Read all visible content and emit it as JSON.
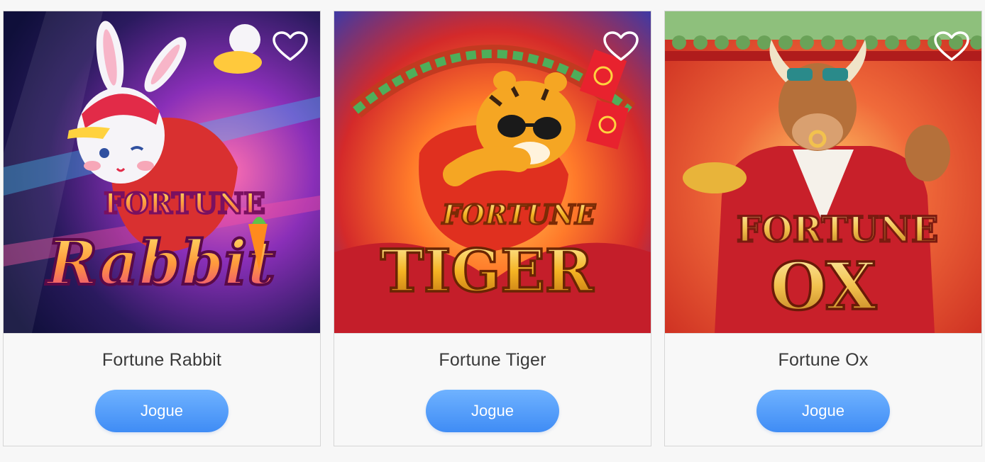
{
  "colors": {
    "page_background": "#f7f7f7",
    "card_background": "#f8f8f8",
    "button_gradient_top": "#6fb2ff",
    "button_gradient_bottom": "#3f8cf5",
    "button_text": "#ffffff",
    "title_text": "#3a3a3a"
  },
  "games": [
    {
      "name": "Fortune Rabbit",
      "button_label": "Jogue",
      "favorite_icon": "heart-outline-icon",
      "thumbnail": {
        "icon": "rabbit-mascot-icon",
        "logo_top": "FORTUNE",
        "logo_bottom": "Rabbit",
        "theme_colors": [
          "#2a1a5e",
          "#e8388a",
          "#ffd23f"
        ]
      }
    },
    {
      "name": "Fortune Tiger",
      "button_label": "Jogue",
      "favorite_icon": "heart-outline-icon",
      "thumbnail": {
        "icon": "tiger-mascot-icon",
        "logo_top": "FORTUNE",
        "logo_bottom": "TIGER",
        "theme_colors": [
          "#3a3aa8",
          "#d42a2a",
          "#f5a623"
        ]
      }
    },
    {
      "name": "Fortune Ox",
      "button_label": "Jogue",
      "favorite_icon": "heart-outline-icon",
      "thumbnail": {
        "icon": "ox-mascot-icon",
        "logo_top": "FORTUNE",
        "logo_bottom": "OX",
        "theme_colors": [
          "#8ec07c",
          "#c8261e",
          "#f2c14e"
        ]
      }
    }
  ]
}
